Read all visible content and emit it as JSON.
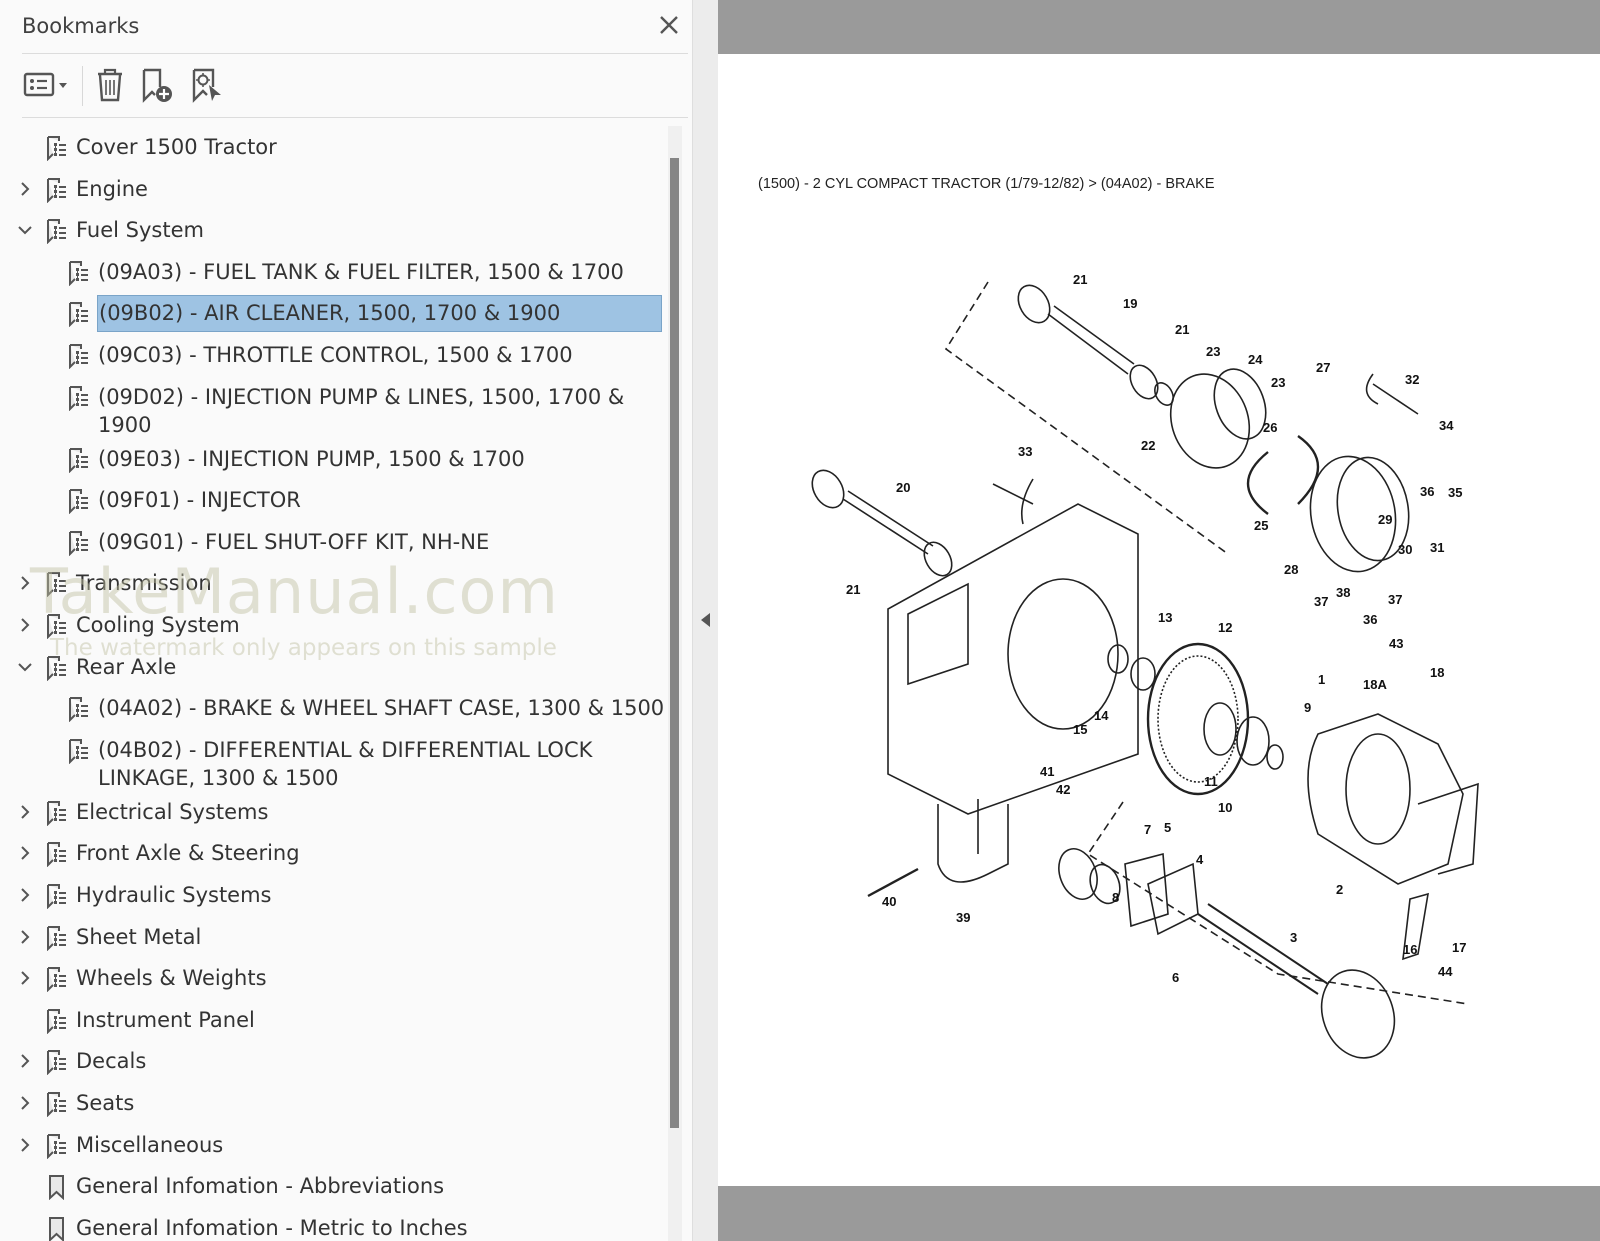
{
  "panel": {
    "title": "Bookmarks",
    "close_icon": "close-icon",
    "toolbar": {
      "options_icon": "list-options-icon",
      "delete_icon": "trash-icon",
      "add_icon": "bookmark-add-icon",
      "find_icon": "bookmark-find-current-icon"
    }
  },
  "bookmarks": [
    {
      "label": "Cover 1500 Tractor",
      "level": 0,
      "expander": "none",
      "icon": "bookmark-tree-icon"
    },
    {
      "label": "Engine",
      "level": 0,
      "expander": "collapsed",
      "icon": "bookmark-tree-icon"
    },
    {
      "label": "Fuel System",
      "level": 0,
      "expander": "expanded",
      "icon": "bookmark-tree-icon"
    },
    {
      "label": "(09A03) - FUEL TANK & FUEL FILTER, 1500 & 1700",
      "level": 1,
      "expander": "none",
      "icon": "bookmark-tree-icon"
    },
    {
      "label": "(09B02) - AIR CLEANER, 1500, 1700 & 1900",
      "level": 1,
      "expander": "none",
      "icon": "bookmark-tree-icon",
      "selected": true
    },
    {
      "label": "(09C03) - THROTTLE CONTROL, 1500 & 1700",
      "level": 1,
      "expander": "none",
      "icon": "bookmark-tree-icon"
    },
    {
      "label": "(09D02) - INJECTION PUMP & LINES, 1500, 1700 & 1900",
      "level": 1,
      "expander": "none",
      "icon": "bookmark-tree-icon"
    },
    {
      "label": "(09E03) - INJECTION PUMP, 1500 & 1700",
      "level": 1,
      "expander": "none",
      "icon": "bookmark-tree-icon"
    },
    {
      "label": "(09F01) - INJECTOR",
      "level": 1,
      "expander": "none",
      "icon": "bookmark-tree-icon"
    },
    {
      "label": "(09G01) - FUEL SHUT-OFF KIT, NH-NE",
      "level": 1,
      "expander": "none",
      "icon": "bookmark-tree-icon"
    },
    {
      "label": "Transmission",
      "level": 0,
      "expander": "collapsed",
      "icon": "bookmark-tree-icon"
    },
    {
      "label": "Cooling System",
      "level": 0,
      "expander": "collapsed",
      "icon": "bookmark-tree-icon"
    },
    {
      "label": "Rear Axle",
      "level": 0,
      "expander": "expanded",
      "icon": "bookmark-tree-icon"
    },
    {
      "label": "(04A02) - BRAKE & WHEEL SHAFT CASE, 1300 & 1500",
      "level": 1,
      "expander": "none",
      "icon": "bookmark-tree-icon"
    },
    {
      "label": "(04B02) - DIFFERENTIAL & DIFFERENTIAL LOCK LINKAGE, 1300 & 1500",
      "level": 1,
      "expander": "none",
      "icon": "bookmark-tree-icon"
    },
    {
      "label": "Electrical Systems",
      "level": 0,
      "expander": "collapsed",
      "icon": "bookmark-tree-icon"
    },
    {
      "label": "Front Axle & Steering",
      "level": 0,
      "expander": "collapsed",
      "icon": "bookmark-tree-icon"
    },
    {
      "label": "Hydraulic Systems",
      "level": 0,
      "expander": "collapsed",
      "icon": "bookmark-tree-icon"
    },
    {
      "label": "Sheet Metal",
      "level": 0,
      "expander": "collapsed",
      "icon": "bookmark-tree-icon"
    },
    {
      "label": "Wheels & Weights",
      "level": 0,
      "expander": "collapsed",
      "icon": "bookmark-tree-icon"
    },
    {
      "label": "Instrument Panel",
      "level": 0,
      "expander": "none",
      "icon": "bookmark-tree-icon"
    },
    {
      "label": "Decals",
      "level": 0,
      "expander": "collapsed",
      "icon": "bookmark-tree-icon"
    },
    {
      "label": "Seats",
      "level": 0,
      "expander": "collapsed",
      "icon": "bookmark-tree-icon"
    },
    {
      "label": "Miscellaneous",
      "level": 0,
      "expander": "collapsed",
      "icon": "bookmark-tree-icon"
    },
    {
      "label": "General Infomation - Abbreviations",
      "level": 0,
      "expander": "none",
      "icon": "bookmark-icon"
    },
    {
      "label": "General Infomation - Metric to Inches",
      "level": 0,
      "expander": "none",
      "icon": "bookmark-icon"
    }
  ],
  "watermark": {
    "title": "TakeManual.com",
    "subtitle": "The watermark only appears on this sample"
  },
  "document": {
    "caption": "(1500) - 2 CYL COMPACT TRACTOR (1/79-12/82) > (04A02) - BRAKE",
    "part_callouts": [
      "1",
      "2",
      "3",
      "4",
      "5",
      "6",
      "7",
      "8",
      "9",
      "10",
      "11",
      "12",
      "13",
      "14",
      "15",
      "16",
      "17",
      "18",
      "18A",
      "19",
      "20",
      "21",
      "21",
      "21",
      "22",
      "23",
      "23",
      "24",
      "25",
      "26",
      "27",
      "28",
      "29",
      "30",
      "31",
      "32",
      "33",
      "34",
      "35",
      "36",
      "36",
      "37",
      "37",
      "38",
      "39",
      "40",
      "41",
      "42",
      "43",
      "44"
    ]
  }
}
